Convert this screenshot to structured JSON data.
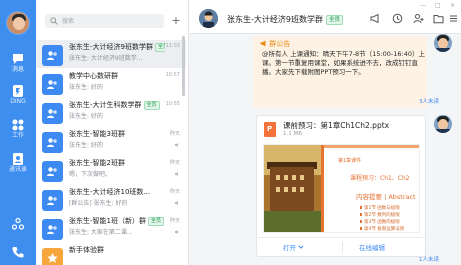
{
  "sidebar": {
    "items": [
      {
        "label": "消息",
        "icon": "chat-icon"
      },
      {
        "label": "DING",
        "icon": "ding-icon"
      },
      {
        "label": "工作",
        "icon": "work-grid-icon"
      },
      {
        "label": "通讯录",
        "icon": "contacts-icon"
      },
      {
        "label": "",
        "icon": "phone-icon"
      }
    ]
  },
  "conversation_list": {
    "search_placeholder": "搜索",
    "add_label": "+",
    "items": [
      {
        "title": "张东生-大计经济9班数学群",
        "tag": "全员",
        "time": "11:03",
        "preview": "张东生: 大计经济9班数学...",
        "highlight": "",
        "selected": true
      },
      {
        "title": "教学中心数研群",
        "tag": "",
        "time": "10:57",
        "preview": "张东生: 好的",
        "highlight": "",
        "selected": false
      },
      {
        "title": "张东生-大计生科数学群",
        "tag": "全员",
        "time": "10:55",
        "preview": "张东生: 好的",
        "highlight": "",
        "selected": false
      },
      {
        "title": "张东生-智能3班群",
        "tag": "",
        "time": "昨天",
        "preview": "张东生: 好的",
        "highlight": "",
        "selected": false
      },
      {
        "title": "张东生-智能2班群",
        "tag": "",
        "time": "昨天",
        "preview": "嗯，下次做吧。",
        "highlight": "",
        "selected": false
      },
      {
        "title": "张东生-大计经济10班数...",
        "tag": "",
        "time": "昨天",
        "preview": "[群公告] 张东生: 好的",
        "highlight": "",
        "selected": false
      },
      {
        "title": "张东生-智能1班（新）群",
        "tag": "全员",
        "time": "昨天",
        "preview": "张东生: 大家在第二课...",
        "highlight": "",
        "selected": false
      },
      {
        "title": "新手体验群",
        "tag": "",
        "time": "",
        "preview": "",
        "highlight": "",
        "selected": false
      }
    ]
  },
  "chat": {
    "title": "张东生-大计经济9班数学群",
    "tag": "全员",
    "window_controls": [
      "—",
      "□",
      "×"
    ],
    "announcement": {
      "header": "群公告",
      "body": "@所有人 上课通知：晴天下午7-8节（15:00-16:40）上课。第一节重复用课堂，如果系统进不去，改成钉钉直播。大家先下载附图PPT预习一下。",
      "read_status": "3人未读"
    },
    "file_card": {
      "file_name": "课前预习：第1章Ch1Ch2.pptx",
      "file_size": "1.1 MB",
      "slide_cover_label": "第1章课件",
      "slide_lesson": "课程预习：Ch1、Ch2",
      "slide_toc": "内容提要 | Abstract",
      "slide_items": [
        "第1节 函数与极限",
        "第2节 数列的极限",
        "第3节 函数的极限",
        "第4节 极限运算法则"
      ],
      "open_label": "打开",
      "edit_label": "在线编辑",
      "read_status": "1人未读"
    }
  },
  "colors": {
    "accent": "#3e8ef0",
    "tag_green": "#1c9a4d",
    "announce_bg": "#fdf2e3",
    "announce_head": "#e98a15"
  }
}
